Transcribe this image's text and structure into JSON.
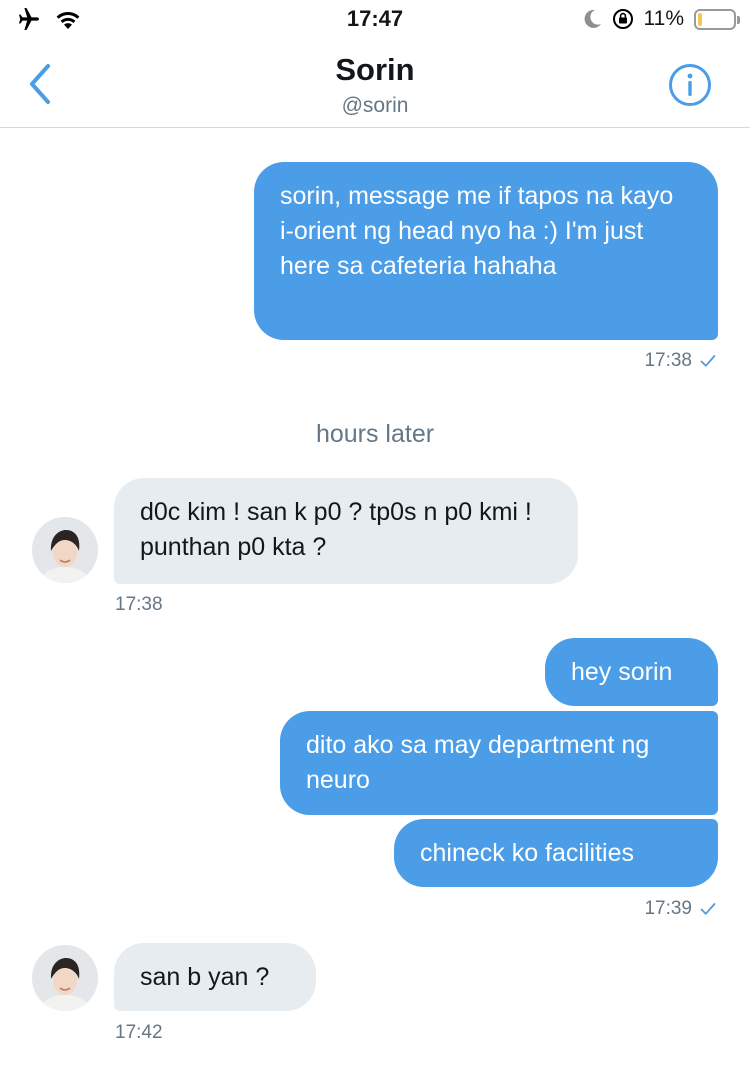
{
  "status_bar": {
    "time": "17:47",
    "battery_text": "11%",
    "battery_level": 0.11,
    "icons": [
      "airplane-icon",
      "wifi-icon",
      "moon-icon",
      "orientation-lock-icon",
      "battery-icon"
    ]
  },
  "header": {
    "title": "Sorin",
    "handle": "@sorin",
    "back_icon": "chevron-left-icon",
    "info_icon": "info-icon"
  },
  "colors": {
    "accent": "#4a9de6",
    "sent_bubble": "#4a9de6",
    "received_bubble": "#e6ecf0",
    "meta_text": "#657786"
  },
  "conversation": {
    "m1": {
      "text": "sorin, message me if tapos na kayo i-orient ng head nyo ha :) I'm just here sa cafeteria hahaha",
      "time": "17:38"
    },
    "divider": "hours later",
    "m2": {
      "text": "d0c kim ! san k p0 ? tp0s n p0 kmi ! punthan p0 kta ?",
      "time": "17:38"
    },
    "m3": {
      "text": "hey sorin"
    },
    "m4": {
      "text": "dito ako sa may department ng neuro"
    },
    "m5": {
      "text": "chineck ko facilities",
      "time": "17:39"
    },
    "m6": {
      "text": "san b yan ?",
      "time": "17:42"
    }
  }
}
